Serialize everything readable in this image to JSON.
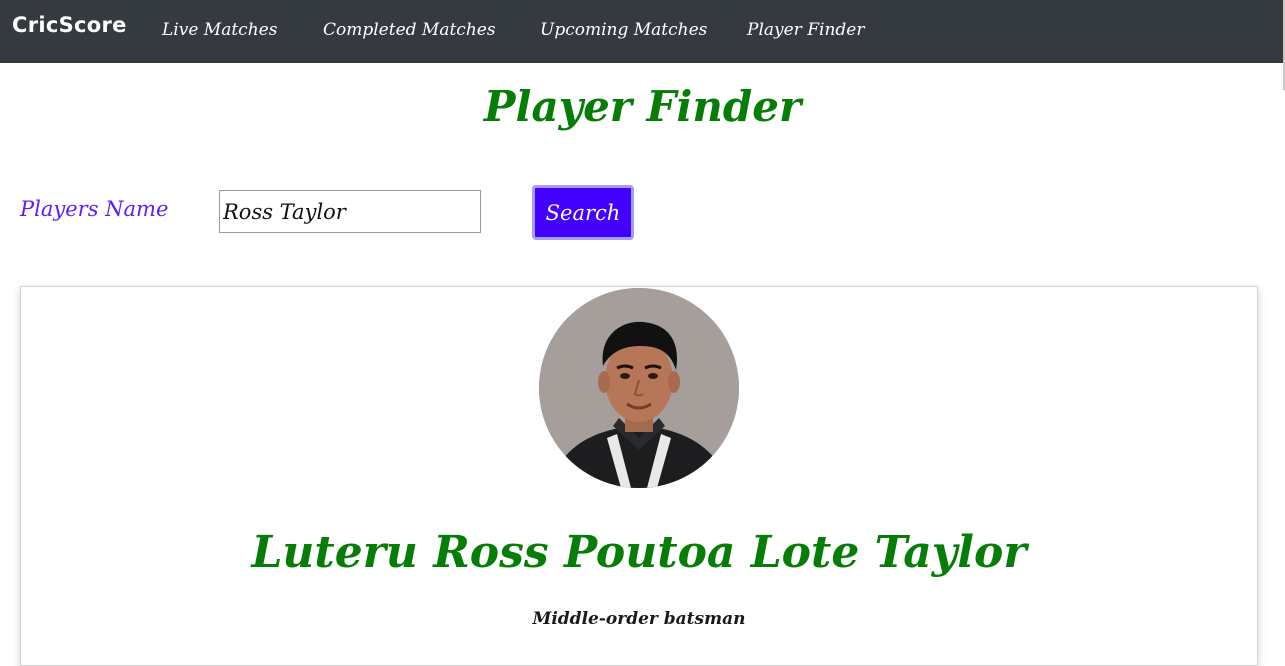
{
  "navbar": {
    "brand": "CricScore",
    "links": [
      {
        "label": "Live Matches"
      },
      {
        "label": "Completed Matches"
      },
      {
        "label": "Upcoming Matches"
      },
      {
        "label": "Player Finder"
      }
    ]
  },
  "page": {
    "title": "Player Finder"
  },
  "search": {
    "label": "Players Name",
    "value": "Ross Taylor",
    "button_label": "Search"
  },
  "player": {
    "name": "Luteru Ross Poutoa Lote Taylor",
    "role": "Middle-order batsman"
  },
  "colors": {
    "navbar_bg": "#343a40",
    "title_green": "#067d06",
    "label_purple": "#5a1dff",
    "button_bg": "#4200ff"
  }
}
